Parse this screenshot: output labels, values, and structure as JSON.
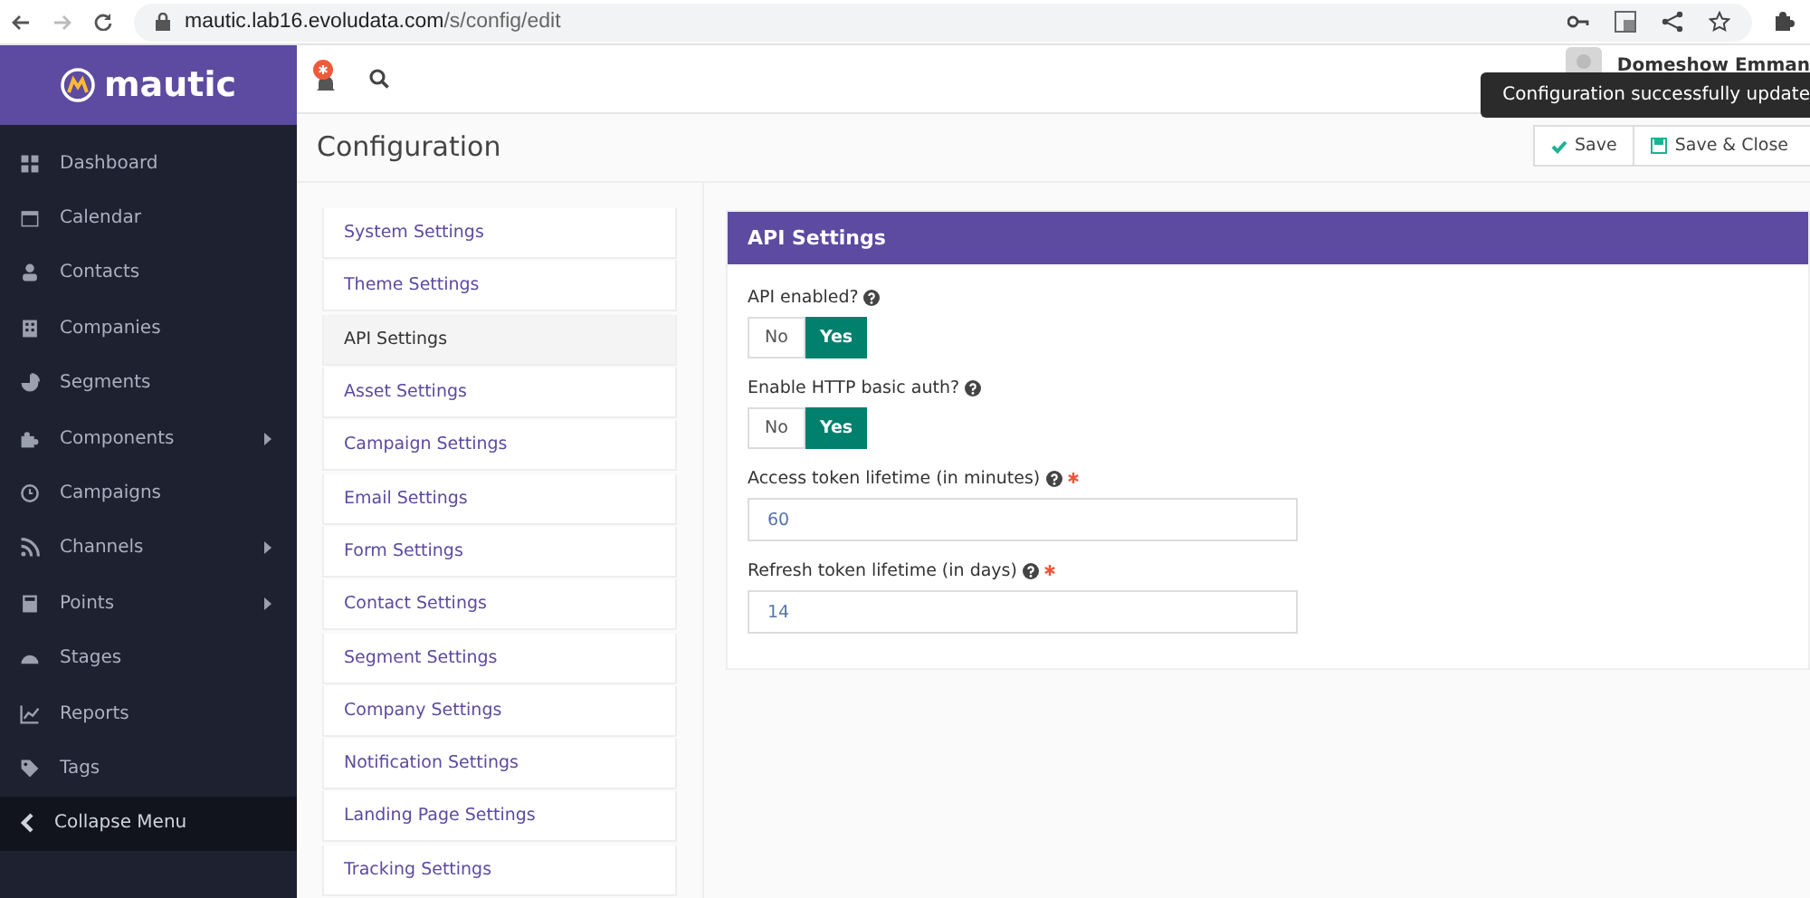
{
  "browser": {
    "url_host": "mautic.lab16.evoludata.com",
    "url_path": "/s/config/edit"
  },
  "logo": {
    "text": "mautic"
  },
  "sidebar": {
    "items": [
      {
        "label": "Dashboard",
        "submenu": false
      },
      {
        "label": "Calendar",
        "submenu": false
      },
      {
        "label": "Contacts",
        "submenu": false
      },
      {
        "label": "Companies",
        "submenu": false
      },
      {
        "label": "Segments",
        "submenu": false
      },
      {
        "label": "Components",
        "submenu": true
      },
      {
        "label": "Campaigns",
        "submenu": false
      },
      {
        "label": "Channels",
        "submenu": true
      },
      {
        "label": "Points",
        "submenu": true
      },
      {
        "label": "Stages",
        "submenu": false
      },
      {
        "label": "Reports",
        "submenu": false
      },
      {
        "label": "Tags",
        "submenu": false
      }
    ],
    "collapse": "Collapse Menu"
  },
  "topbar": {
    "user_name": "Domeshow Emman"
  },
  "toast": {
    "message": "Configuration successfully update"
  },
  "page": {
    "title": "Configuration",
    "buttons": [
      {
        "label": "Save",
        "kind": "check"
      },
      {
        "label": "Save & Close",
        "kind": "disk"
      }
    ]
  },
  "config_nav": [
    {
      "label": "System Settings",
      "selected": false
    },
    {
      "label": "Theme Settings",
      "selected": false
    },
    {
      "label": "API Settings",
      "selected": true
    },
    {
      "label": "Asset Settings",
      "selected": false
    },
    {
      "label": "Campaign Settings",
      "selected": false
    },
    {
      "label": "Email Settings",
      "selected": false
    },
    {
      "label": "Form Settings",
      "selected": false
    },
    {
      "label": "Contact Settings",
      "selected": false
    },
    {
      "label": "Segment Settings",
      "selected": false
    },
    {
      "label": "Company Settings",
      "selected": false
    },
    {
      "label": "Notification Settings",
      "selected": false
    },
    {
      "label": "Landing Page Settings",
      "selected": false
    },
    {
      "label": "Tracking Settings",
      "selected": false
    }
  ],
  "panel": {
    "title": "API Settings",
    "fields": [
      {
        "kind": "toggle",
        "label": "API enabled?",
        "required": false,
        "options": [
          {
            "label": "No",
            "selected": false
          },
          {
            "label": "Yes",
            "selected": true
          }
        ]
      },
      {
        "kind": "toggle",
        "label": "Enable HTTP basic auth?",
        "required": false,
        "options": [
          {
            "label": "No",
            "selected": false
          },
          {
            "label": "Yes",
            "selected": true
          }
        ]
      },
      {
        "kind": "text",
        "label": "Access token lifetime (in minutes)",
        "required": true,
        "value": "60"
      },
      {
        "kind": "text",
        "label": "Refresh token lifetime (in days)",
        "required": true,
        "value": "14"
      }
    ]
  }
}
